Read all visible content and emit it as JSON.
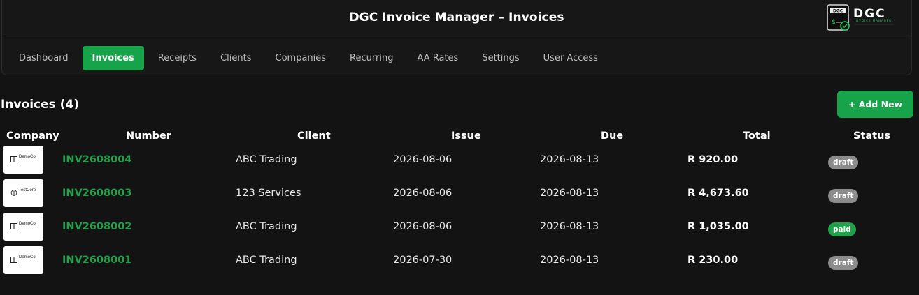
{
  "header": {
    "title": "DGC Invoice Manager – Invoices",
    "logo": {
      "brand": "DGC",
      "tagline": "INVOICE MANAGER"
    }
  },
  "nav": {
    "tabs": [
      {
        "label": "Dashboard",
        "active": false
      },
      {
        "label": "Invoices",
        "active": true
      },
      {
        "label": "Receipts",
        "active": false
      },
      {
        "label": "Clients",
        "active": false
      },
      {
        "label": "Companies",
        "active": false
      },
      {
        "label": "Recurring",
        "active": false
      },
      {
        "label": "AA Rates",
        "active": false
      },
      {
        "label": "Settings",
        "active": false
      },
      {
        "label": "User Access",
        "active": false
      }
    ]
  },
  "page": {
    "heading": "Invoices (4)",
    "add_label": "+ Add New"
  },
  "table": {
    "headers": {
      "company": "Company",
      "number": "Number",
      "client": "Client",
      "issue": "Issue",
      "due": "Due",
      "total": "Total",
      "status": "Status"
    },
    "rows": [
      {
        "company": "DemoCo",
        "number": "INV2608004",
        "client": "ABC Trading",
        "issue": "2026-08-06",
        "due": "2026-08-13",
        "total": "R 920.00",
        "status": "draft"
      },
      {
        "company": "TestCorp",
        "number": "INV2608003",
        "client": "123 Services",
        "issue": "2026-08-06",
        "due": "2026-08-13",
        "total": "R 4,673.60",
        "status": "draft"
      },
      {
        "company": "DemoCo",
        "number": "INV2608002",
        "client": "ABC Trading",
        "issue": "2026-08-06",
        "due": "2026-08-13",
        "total": "R 1,035.00",
        "status": "paid"
      },
      {
        "company": "DemoCo",
        "number": "INV2608001",
        "client": "ABC Trading",
        "issue": "2026-07-30",
        "due": "2026-08-13",
        "total": "R 230.00",
        "status": "draft"
      }
    ]
  },
  "colors": {
    "accent": "#16a34a",
    "link": "#22a04b",
    "draft": "#8c8c8c",
    "background": "#131313"
  }
}
